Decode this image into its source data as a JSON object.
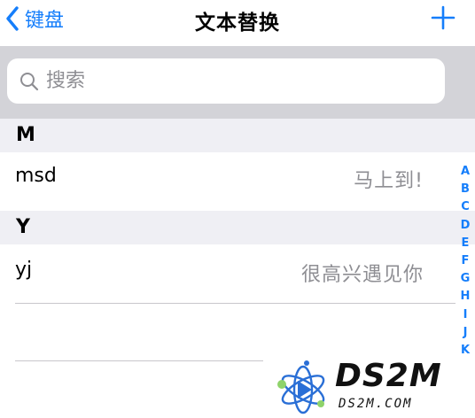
{
  "nav": {
    "back_label": "键盘",
    "title": "文本替换"
  },
  "search": {
    "placeholder": "搜索"
  },
  "sections": [
    {
      "header": "M",
      "items": [
        {
          "phrase": "msd",
          "replacement": "马上到!"
        }
      ]
    },
    {
      "header": "Y",
      "items": [
        {
          "phrase": "yj",
          "replacement": "很高兴遇见你"
        }
      ]
    }
  ],
  "index": [
    "A",
    "B",
    "C",
    "D",
    "E",
    "F",
    "G",
    "H",
    "I",
    "J",
    "K"
  ],
  "watermark": {
    "title": "DS2M",
    "url": "DS2M.COM"
  },
  "colors": {
    "accent": "#157efb",
    "secondary_text": "#8e8e93",
    "search_bg": "#d3d3d8",
    "section_bg": "#efeff4",
    "separator": "#c8c7cc"
  }
}
